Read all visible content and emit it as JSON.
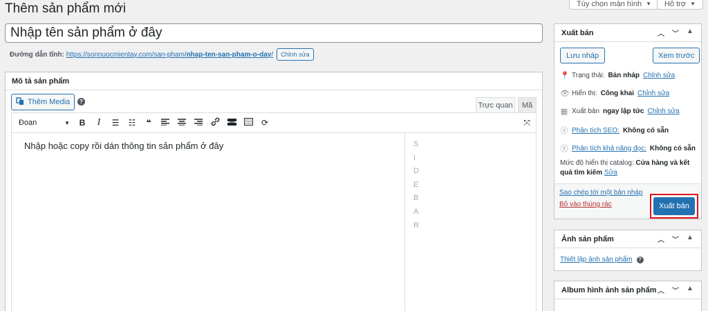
{
  "header": {
    "page_title": "Thêm sản phẩm mới",
    "screen_options": "Tùy chọn màn hình",
    "help": "Hỗ trợ"
  },
  "title_field": {
    "placeholder": "Nhập tên sản phẩm ở đây"
  },
  "permalink": {
    "label": "Đường dẫn tĩnh:",
    "url_base": "https://sonnuocmientay.com/san-pham/",
    "slug": "nhap-ten-san-pham-o-day",
    "url_tail": "/",
    "edit": "Chỉnh sửa"
  },
  "description": {
    "heading": "Mô tả sản phẩm",
    "add_media": "Thêm Media",
    "tab_visual": "Trực quan",
    "tab_code": "Mã",
    "format_select": "Đoạn",
    "content": "Nhập hoặc copy rồi dán thông tin sản phẩm ở đây",
    "sidebar_letters": [
      "S",
      "I",
      "D",
      "E",
      "B",
      "A",
      "R"
    ]
  },
  "publish": {
    "heading": "Xuất bản",
    "save_draft": "Lưu nháp",
    "preview": "Xem trước",
    "status_label": "Trạng thái:",
    "status_value": "Bản nháp",
    "visibility_label": "Hiển thị:",
    "visibility_value": "Công khai",
    "publish_label": "Xuất bản",
    "publish_value": "ngay lập tức",
    "edit": "Chỉnh sửa",
    "seo_link": "Phân tích SEO:",
    "seo_value": "Không có sẵn",
    "readability_link": "Phân tích khả năng đọc:",
    "readability_value": "Không có sẵn",
    "catalog_label": "Mức độ hiển thị catalog:",
    "catalog_value": "Cửa hàng và kết quả tìm kiếm",
    "catalog_edit": "Sửa",
    "copy_draft": "Sao chép tới một bản nháp",
    "trash": "Bỏ vào thùng rác",
    "publish_button": "Xuất bản"
  },
  "product_image": {
    "heading": "Ảnh sản phẩm",
    "set_image": "Thiết lập ảnh sản phẩm"
  },
  "gallery": {
    "heading": "Album hình ảnh sản phẩm"
  },
  "colors": {
    "accent": "#2271b1",
    "highlight_border": "#e0141e",
    "trash": "#b32d2e"
  }
}
